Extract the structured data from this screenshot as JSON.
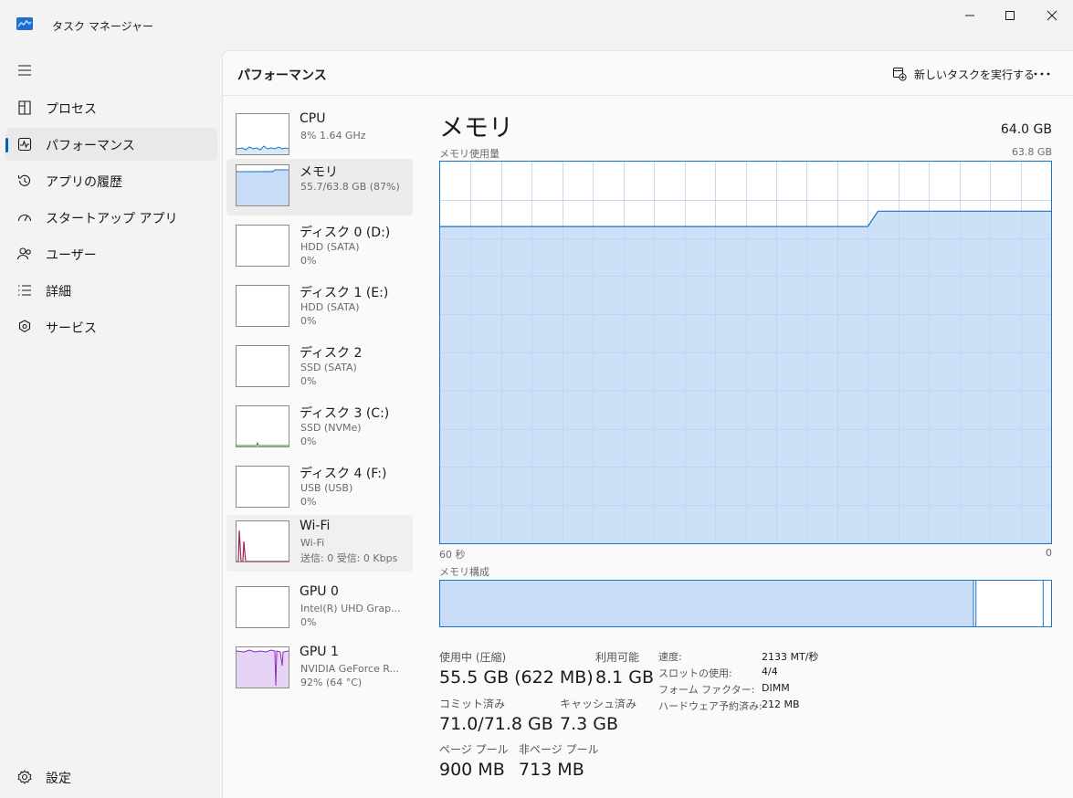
{
  "app": {
    "title": "タスク マネージャー"
  },
  "sidebar": {
    "items": [
      {
        "label": "プロセス"
      },
      {
        "label": "パフォーマンス"
      },
      {
        "label": "アプリの履歴"
      },
      {
        "label": "スタートアップ アプリ"
      },
      {
        "label": "ユーザー"
      },
      {
        "label": "詳細"
      },
      {
        "label": "サービス"
      }
    ],
    "settings_label": "設定"
  },
  "header": {
    "title": "パフォーマンス",
    "run_task_label": "新しいタスクを実行する"
  },
  "devices": [
    {
      "name": "CPU",
      "sub1": "8%  1.64 GHz",
      "sub2": ""
    },
    {
      "name": "メモリ",
      "sub1": "55.7/63.8 GB (87%)",
      "sub2": ""
    },
    {
      "name": "ディスク 0 (D:)",
      "sub1": "HDD (SATA)",
      "sub2": "0%"
    },
    {
      "name": "ディスク 1 (E:)",
      "sub1": "HDD (SATA)",
      "sub2": "0%"
    },
    {
      "name": "ディスク 2",
      "sub1": "SSD (SATA)",
      "sub2": "0%"
    },
    {
      "name": "ディスク 3 (C:)",
      "sub1": "SSD (NVMe)",
      "sub2": "0%"
    },
    {
      "name": "ディスク 4 (F:)",
      "sub1": "USB (USB)",
      "sub2": "0%"
    },
    {
      "name": "Wi-Fi",
      "sub1": "Wi-Fi",
      "sub2": "送信: 0 受信: 0 Kbps"
    },
    {
      "name": "GPU 0",
      "sub1": "Intel(R) UHD Grap...",
      "sub2": "0%"
    },
    {
      "name": "GPU 1",
      "sub1": "NVIDIA GeForce R...",
      "sub2": "92% (64 °C)"
    }
  ],
  "detail": {
    "title": "メモリ",
    "total": "64.0 GB",
    "usage_label": "メモリ使用量",
    "usage_max": "63.8 GB",
    "time_left": "60 秒",
    "time_right": "0",
    "composition_label": "メモリ構成",
    "usage_history_fraction": [
      0.83,
      0.83,
      0.83,
      0.83,
      0.83,
      0.83,
      0.83,
      0.83,
      0.83,
      0.83,
      0.83,
      0.83,
      0.83,
      0.83,
      0.83,
      0.83,
      0.83,
      0.83,
      0.83,
      0.83,
      0.83,
      0.83,
      0.83,
      0.83,
      0.83,
      0.83,
      0.83,
      0.83,
      0.83,
      0.83,
      0.83,
      0.83,
      0.83,
      0.83,
      0.83,
      0.83,
      0.83,
      0.83,
      0.83,
      0.83,
      0.83,
      0.83,
      0.83,
      0.87,
      0.87,
      0.87,
      0.87,
      0.87,
      0.87,
      0.87,
      0.87,
      0.87,
      0.87,
      0.87,
      0.87,
      0.87,
      0.87,
      0.87,
      0.87,
      0.87,
      0.87
    ],
    "composition": {
      "in_use_fraction": 0.873,
      "modified_fraction": 0.004,
      "standby_fraction": 0.11
    },
    "stats": {
      "in_use_label": "使用中 (圧縮)",
      "in_use_value": "55.5 GB (622 MB)",
      "available_label": "利用可能",
      "available_value": "8.1 GB",
      "committed_label": "コミット済み",
      "committed_value": "71.0/71.8 GB",
      "cached_label": "キャッシュ済み",
      "cached_value": "7.3 GB",
      "paged_label": "ページ プール",
      "paged_value": "900 MB",
      "nonpaged_label": "非ページ プール",
      "nonpaged_value": "713 MB"
    },
    "props": [
      {
        "key": "速度:",
        "value": "2133 MT/秒"
      },
      {
        "key": "スロットの使用:",
        "value": "4/4"
      },
      {
        "key": "フォーム ファクター:",
        "value": "DIMM"
      },
      {
        "key": "ハードウェア予約済み:",
        "value": "212 MB"
      }
    ]
  },
  "colors": {
    "accent": "#005fb8",
    "memory_fill": "#c9dcf7",
    "memory_line": "#1a73c6",
    "wifi_line": "#a0245c",
    "gpu_fill": "#e6d3f5",
    "gpu_line": "#8a2ab8"
  }
}
